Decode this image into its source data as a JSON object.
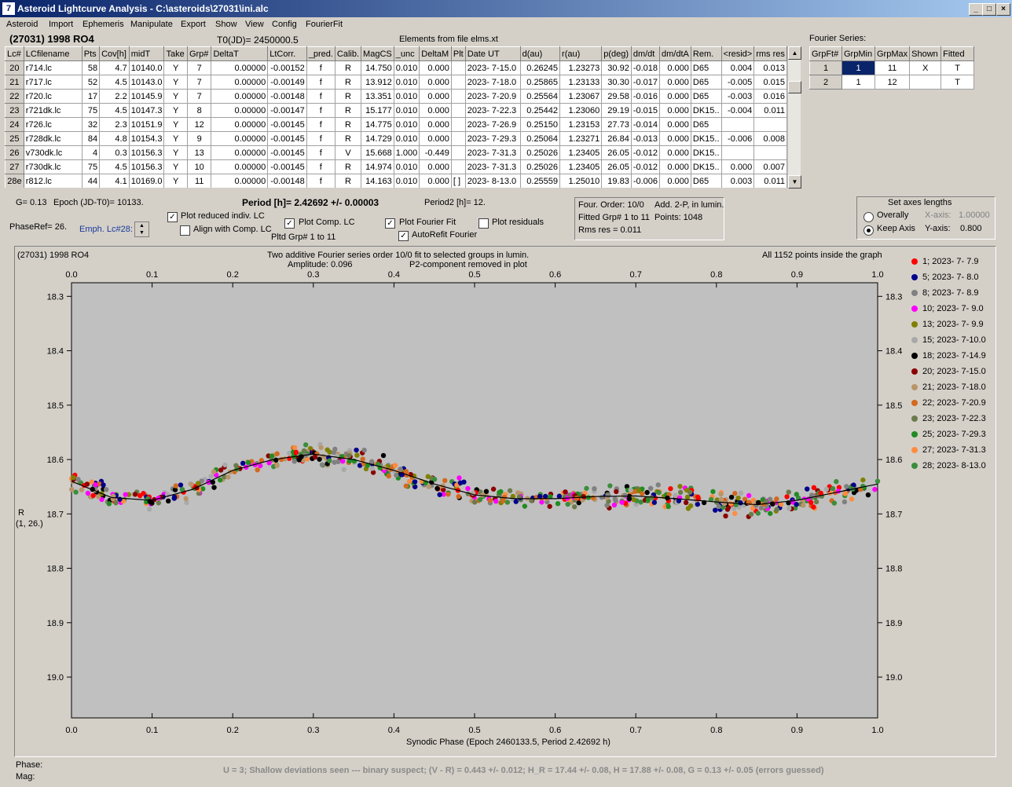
{
  "window": {
    "title": "Asteroid Lightcurve Analysis - C:\\asteroids\\27031\\ini.alc",
    "icon": "7"
  },
  "menu": [
    "Asteroid",
    "Import",
    "Ephemeris",
    "Manipulate",
    "Export",
    "Show",
    "View",
    "Config",
    "FourierFit"
  ],
  "header": {
    "object": "(27031) 1998 RO4",
    "t0": "T0(JD)= 2450000.5",
    "elements": "Elements from file elms.xt"
  },
  "table": {
    "columns": [
      "Lc#",
      "LCfilename",
      "Pts",
      "Cov[h]",
      "midT",
      "Take",
      "Grp#",
      "DeltaT",
      "LtCorr.",
      "_pred.",
      "Calib.",
      "MagCS",
      "_unc",
      "DeltaM",
      "Plt",
      "Date UT",
      "d(au)",
      "r(au)",
      "p(deg)",
      "dm/dt",
      "dm/dtA",
      "Rem.",
      "<resid>",
      "rms res"
    ],
    "rows": [
      [
        "20",
        "r714.lc",
        "58",
        "4.7",
        "10140.0",
        "Y",
        "7",
        "0.00000",
        "-0.00152",
        "f",
        "R",
        "14.750",
        "0.010",
        "0.000",
        "",
        "2023- 7-15.0",
        "0.26245",
        "1.23273",
        "30.92",
        "-0.018",
        "0.000",
        "D65",
        "0.004",
        "0.013"
      ],
      [
        "21",
        "r717.lc",
        "52",
        "4.5",
        "10143.0",
        "Y",
        "7",
        "0.00000",
        "-0.00149",
        "f",
        "R",
        "13.912",
        "0.010",
        "0.000",
        "",
        "2023- 7-18.0",
        "0.25865",
        "1.23133",
        "30.30",
        "-0.017",
        "0.000",
        "D65",
        "-0.005",
        "0.015"
      ],
      [
        "22",
        "r720.lc",
        "17",
        "2.2",
        "10145.9",
        "Y",
        "7",
        "0.00000",
        "-0.00148",
        "f",
        "R",
        "13.351",
        "0.010",
        "0.000",
        "",
        "2023- 7-20.9",
        "0.25564",
        "1.23067",
        "29.58",
        "-0.016",
        "0.000",
        "D65",
        "-0.003",
        "0.016"
      ],
      [
        "23",
        "r721dk.lc",
        "75",
        "4.5",
        "10147.3",
        "Y",
        "8",
        "0.00000",
        "-0.00147",
        "f",
        "R",
        "15.177",
        "0.010",
        "0.000",
        "",
        "2023- 7-22.3",
        "0.25442",
        "1.23060",
        "29.19",
        "-0.015",
        "0.000",
        "DK15..",
        "-0.004",
        "0.011"
      ],
      [
        "24",
        "r726.lc",
        "32",
        "2.3",
        "10151.9",
        "Y",
        "12",
        "0.00000",
        "-0.00145",
        "f",
        "R",
        "14.775",
        "0.010",
        "0.000",
        "",
        "2023- 7-26.9",
        "0.25150",
        "1.23153",
        "27.73",
        "-0.014",
        "0.000",
        "D65",
        "",
        ""
      ],
      [
        "25",
        "r728dk.lc",
        "84",
        "4.8",
        "10154.3",
        "Y",
        "9",
        "0.00000",
        "-0.00145",
        "f",
        "R",
        "14.729",
        "0.010",
        "0.000",
        "",
        "2023- 7-29.3",
        "0.25064",
        "1.23271",
        "26.84",
        "-0.013",
        "0.000",
        "DK15..",
        "-0.006",
        "0.008"
      ],
      [
        "26",
        "v730dk.lc",
        "4",
        "0.3",
        "10156.3",
        "Y",
        "13",
        "0.00000",
        "-0.00145",
        "f",
        "V",
        "15.668",
        "1.000",
        "-0.449",
        "",
        "2023- 7-31.3",
        "0.25026",
        "1.23405",
        "26.05",
        "-0.012",
        "0.000",
        "DK15..",
        "",
        ""
      ],
      [
        "27",
        "r730dk.lc",
        "75",
        "4.5",
        "10156.3",
        "Y",
        "10",
        "0.00000",
        "-0.00145",
        "f",
        "R",
        "14.974",
        "0.010",
        "0.000",
        "",
        "2023- 7-31.3",
        "0.25026",
        "1.23405",
        "26.05",
        "-0.012",
        "0.000",
        "DK15..",
        "0.000",
        "0.007"
      ],
      [
        "28e",
        "r812.lc",
        "44",
        "4.1",
        "10169.0",
        "Y",
        "11",
        "0.00000",
        "-0.00148",
        "f",
        "R",
        "14.163",
        "0.010",
        "0.000",
        "[ ]",
        "2023- 8-13.0",
        "0.25559",
        "1.25010",
        "19.83",
        "-0.006",
        "0.000",
        "D65",
        "0.003",
        "0.011"
      ]
    ]
  },
  "fourier_series": {
    "label": "Fourier Series:",
    "columns": [
      "GrpFt#",
      "GrpMin",
      "GrpMax",
      "Shown",
      "Fitted"
    ],
    "rows": [
      [
        "1",
        "1",
        "11",
        "X",
        "T"
      ],
      [
        "2",
        "1",
        "12",
        "",
        "T"
      ]
    ]
  },
  "controls": {
    "g": "G= 0.13",
    "epoch": "Epoch (JD-T0)= 10133.",
    "period": "Period [h]= 2.42692 +/- 0.00003",
    "period2": "Period2 [h]= 12.",
    "phaseref": "PhaseRef= 26.",
    "emph": "Emph. Lc#28:",
    "plot_reduced": "Plot reduced indiv. LC",
    "align_comp": "Align with Comp. LC",
    "plot_comp": "Plot Comp. LC",
    "pltd_grp": "Pltd Grp#  1   to    11",
    "plot_fourier": "Plot Fourier Fit",
    "autorefit": "AutoRefit Fourier",
    "plot_residuals": "Plot residuals"
  },
  "fit_info": {
    "order": "Four. Order: 10/0",
    "add": "Add. 2-P, in lumin.",
    "fitted": "Fitted Grp# 1 to 11",
    "points": "Points: 1048",
    "rms": "Rms res      = 0.011"
  },
  "axes_box": {
    "title": "Set axes lengths",
    "overally": "Overally",
    "keep": "Keep Axis",
    "xaxis_label": "X-axis:",
    "xaxis_val": "1.00000",
    "yaxis_label": "Y-axis:",
    "yaxis_val": "0.800"
  },
  "plot": {
    "object": "(27031) 1998 RO4",
    "title1": "Two additive Fourier series order 10/0 fit to selected groups in lumin.",
    "amplitude": "Amplitude: 0.096",
    "p2": "P2-component removed in plot",
    "points_info": "All 1152 points inside the graph",
    "xlabel": "Synodic Phase (Epoch 2460133.5, Period 2.42692 h)",
    "ylabel1": "R",
    "ylabel2": "(1, 26.)"
  },
  "chart_data": {
    "type": "scatter",
    "x_ticks": [
      "0.0",
      "0.1",
      "0.2",
      "0.3",
      "0.4",
      "0.5",
      "0.6",
      "0.7",
      "0.8",
      "0.9",
      "1.0"
    ],
    "y_ticks": [
      "18.3",
      "18.4",
      "18.5",
      "18.6",
      "18.7",
      "18.8",
      "18.9",
      "19.0"
    ],
    "xlim": [
      0,
      1
    ],
    "ylim": [
      19.075,
      18.275
    ],
    "fit_curve": {
      "x": [
        0.0,
        0.05,
        0.1,
        0.15,
        0.2,
        0.25,
        0.3,
        0.35,
        0.4,
        0.45,
        0.5,
        0.55,
        0.6,
        0.65,
        0.7,
        0.75,
        0.8,
        0.85,
        0.9,
        0.95,
        1.0
      ],
      "y": [
        18.64,
        18.67,
        18.675,
        18.655,
        18.62,
        18.6,
        18.59,
        18.6,
        18.62,
        18.645,
        18.665,
        18.672,
        18.672,
        18.668,
        18.667,
        18.672,
        18.678,
        18.683,
        18.675,
        18.66,
        18.645
      ]
    },
    "series": [
      {
        "name": "1; 2023- 7- 7.9",
        "color": "#ff0000"
      },
      {
        "name": "5; 2023- 7- 8.0",
        "color": "#00008b"
      },
      {
        "name": "8; 2023- 7- 8.9",
        "color": "#808080"
      },
      {
        "name": "10; 2023- 7- 9.0",
        "color": "#ff00ff"
      },
      {
        "name": "13; 2023- 7- 9.9",
        "color": "#808000"
      },
      {
        "name": "15; 2023- 7-10.0",
        "color": "#a9a9a9"
      },
      {
        "name": "18; 2023- 7-14.9",
        "color": "#000000"
      },
      {
        "name": "20; 2023- 7-15.0",
        "color": "#8b0000"
      },
      {
        "name": "21; 2023- 7-18.0",
        "color": "#b8956a"
      },
      {
        "name": "22; 2023- 7-20.9",
        "color": "#d2691e"
      },
      {
        "name": "23; 2023- 7-22.3",
        "color": "#6b7b4b"
      },
      {
        "name": "25; 2023- 7-29.3",
        "color": "#228b22"
      },
      {
        "name": "27; 2023- 7-31.3",
        "color": "#ff8c40"
      },
      {
        "name": "28; 2023- 8-13.0",
        "color": "#3c8c3c"
      }
    ]
  },
  "status": {
    "phase": "Phase:",
    "mag": "Mag:",
    "summary": "U = 3; Shallow deviations seen --- binary suspect; (V - R) = 0.443 +/- 0.012; H_R = 17.44 +/- 0.08, H = 17.88 +/- 0.08, G = 0.13 +/- 0.05 (errors guessed)"
  }
}
